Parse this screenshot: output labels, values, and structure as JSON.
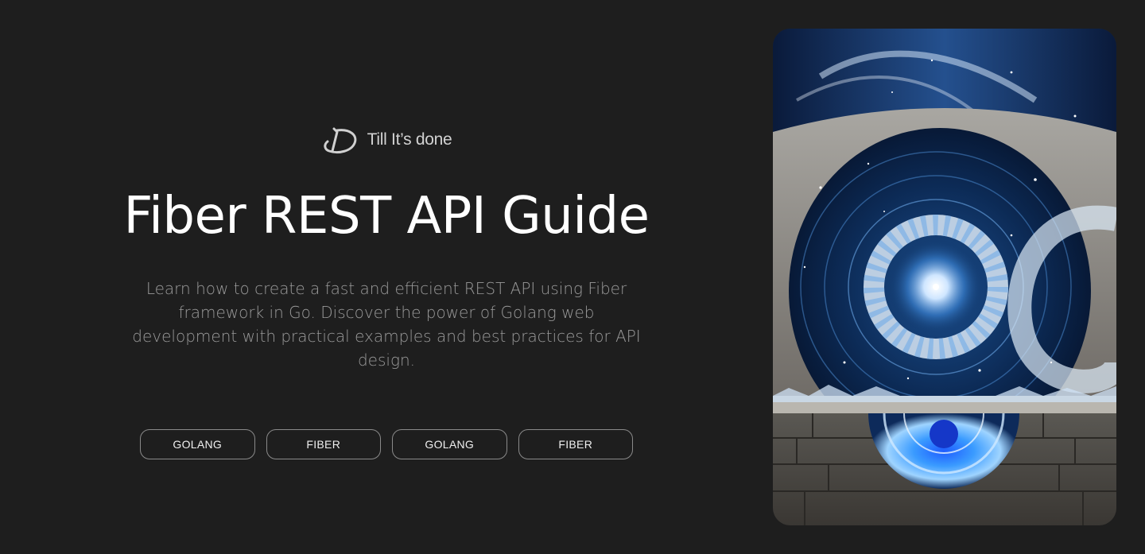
{
  "brand": {
    "name": "Till It’s done",
    "logo_icon": "td-monogram-icon"
  },
  "hero": {
    "title": "Fiber REST API Guide",
    "description": "Learn how to create a fast and efficient REST API using Fiber framework in Go. Discover the power of Golang web development with practical examples and best practices for API design."
  },
  "tags": [
    {
      "label": "GOLANG"
    },
    {
      "label": "FIBER"
    },
    {
      "label": "GOLANG"
    },
    {
      "label": "FIBER"
    }
  ],
  "colors": {
    "background": "#1e1e1e",
    "title": "#ffffff",
    "description": "#9a9a9a",
    "tag_border": "#8a8a8a"
  }
}
